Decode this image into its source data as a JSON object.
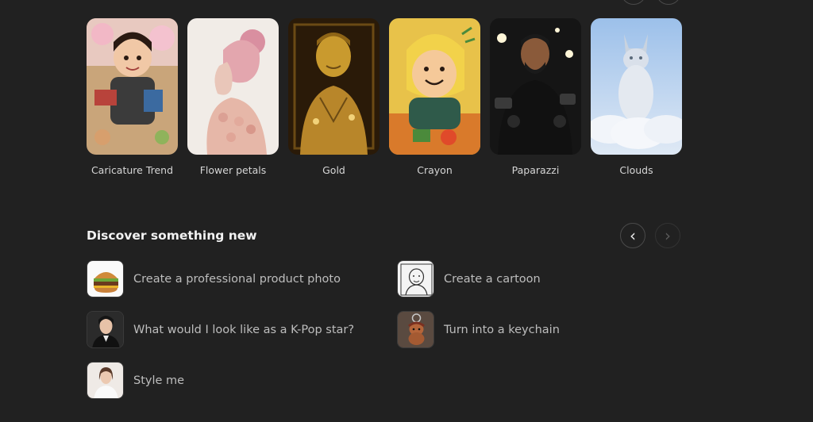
{
  "style_tiles": [
    {
      "label": "Caricature Trend",
      "icon": "caricature-image"
    },
    {
      "label": "Flower petals",
      "icon": "flower-petals-image"
    },
    {
      "label": "Gold",
      "icon": "gold-statue-image"
    },
    {
      "label": "Crayon",
      "icon": "crayon-drawing-image"
    },
    {
      "label": "Paparazzi",
      "icon": "paparazzi-image"
    },
    {
      "label": "Clouds",
      "icon": "cloud-cat-image"
    }
  ],
  "discover": {
    "title": "Discover something new",
    "items": [
      {
        "label": "Create a professional product photo",
        "icon": "burger-image"
      },
      {
        "label": "Create a cartoon",
        "icon": "cartoon-sketch-image"
      },
      {
        "label": "What would I look like as a K-Pop star?",
        "icon": "kpop-portrait-image"
      },
      {
        "label": "Turn into a keychain",
        "icon": "keychain-image"
      },
      {
        "label": "Style me",
        "icon": "style-portrait-image"
      }
    ]
  },
  "nav": {
    "prev_icon": "‹",
    "next_icon": "›"
  },
  "colors": {
    "background": "#212121",
    "text": "#ececec",
    "muted_text": "#bdbdbd"
  }
}
